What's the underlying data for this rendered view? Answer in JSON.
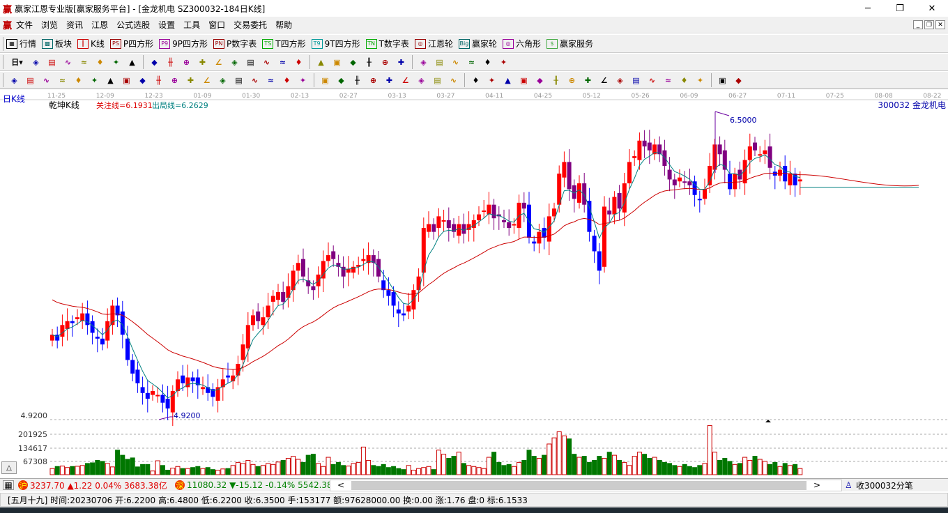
{
  "window": {
    "title": "赢家江恩专业版[赢家服务平台] - [金龙机电  SZ300032-184日K线]",
    "logo": "赢",
    "minimize": "─",
    "maximize": "❐",
    "close": "✕"
  },
  "menu": [
    "文件",
    "浏览",
    "资讯",
    "江恩",
    "公式选股",
    "设置",
    "工具",
    "窗口",
    "交易委托",
    "帮助"
  ],
  "mdi": [
    "_",
    "❐",
    "✕"
  ],
  "toolbar1": [
    {
      "icon": "quote-table-icon",
      "badge": "▦",
      "label": "行情"
    },
    {
      "icon": "sector-icon",
      "badge": "▩",
      "label": "板块"
    },
    {
      "icon": "kline-icon",
      "badge": "┃",
      "label": "K线"
    },
    {
      "icon": "ps-icon",
      "badge": "PS",
      "label": "P四方形"
    },
    {
      "icon": "p9-icon",
      "badge": "P9",
      "label": "9P四方形"
    },
    {
      "icon": "pn-icon",
      "badge": "PN",
      "label": "P数字表"
    },
    {
      "icon": "ts-icon",
      "badge": "TS",
      "label": "T四方形"
    },
    {
      "icon": "t9-icon",
      "badge": "T9",
      "label": "9T四方形"
    },
    {
      "icon": "tn-icon",
      "badge": "TN",
      "label": "T数字表"
    },
    {
      "icon": "gann-wheel-icon",
      "badge": "◎",
      "label": "江恩轮"
    },
    {
      "icon": "big-wheel-icon",
      "badge": "Big",
      "label": "赢家轮"
    },
    {
      "icon": "hexagon-icon",
      "badge": "◎",
      "label": "六角形"
    },
    {
      "icon": "dollar-icon",
      "badge": "$",
      "label": "赢家服务"
    }
  ],
  "toolbar2": {
    "period": "日",
    "icons": [
      "chart-type-icon",
      "notes-icon",
      "wave3-icon",
      "wave9-icon",
      "candle-style-icon",
      "kline-select-icon",
      "flag-icon",
      "|",
      "first-icon",
      "last-icon",
      "left-icon",
      "right-icon",
      "move-left-icon",
      "move-right-icon",
      "zoom-in-icon",
      "zoom-out-icon",
      "expand-icon",
      "fit-icon",
      "|",
      "hand-icon",
      "crosshair-icon",
      "line-tool-icon",
      "wave-icon",
      "section-icon",
      "trend-icon",
      "|",
      "calendar-icon",
      "calculator-icon",
      "report-icon",
      "save-icon",
      "network-icon",
      "export-icon"
    ]
  },
  "toolbar3": {
    "icons": [
      "pen-icon",
      "grid-icon",
      "gold-icon",
      "gold2-icon",
      "fib-icon",
      "spiral-icon",
      "rocket-icon",
      "circle-icon",
      "lines-icon",
      "n2-icon",
      "angle-icon",
      "target-icon",
      "star-icon",
      "square-icon",
      "parallel-icon",
      "shen-icon",
      "ying-icon",
      "ruler-icon",
      "span-icon",
      "|",
      "box-icon",
      "fan-icon",
      "fan2-icon",
      "fan3-icon",
      "angle2-icon",
      "zigzag-icon",
      "grid2-icon",
      "grid3-icon",
      "multiline-icon",
      "|",
      "table-icon",
      "percent-fan-icon",
      "percent-icon",
      "percent-line-icon",
      "gold-circle-icon",
      "gold-line-icon",
      "arrow-icon",
      "wave-line-icon",
      "gold3-icon",
      "j-icon",
      "f-icon",
      "gold4-icon",
      "shen2-icon",
      "ying2-icon",
      "box2-icon",
      "|",
      "ball-icon",
      "infinity-icon"
    ]
  },
  "chart": {
    "period_label": "日K线",
    "indicator": "乾坤K线",
    "focus": "关注线=6.1931",
    "exit": "出局线=6.2629",
    "stock": "300032  金龙机电",
    "high_label": "6.5000",
    "low_label": "4.9200",
    "low_axis": "4.9200",
    "dates": [
      "11-25",
      "12-09",
      "12-23",
      "01-09",
      "01-30",
      "02-13",
      "02-27",
      "03-13",
      "03-27",
      "04-11",
      "04-25",
      "05-12",
      "05-26",
      "06-09",
      "06-27",
      "07-11",
      "07-25",
      "08-08",
      "08-22"
    ],
    "vol_axis": [
      "201925",
      "134617",
      "67308"
    ],
    "colors": {
      "up": "#ff0000",
      "down": "#0000ff",
      "mid": "#800080",
      "ma_short": "#008080",
      "ma_long": "#cc0000",
      "vol_up": "#cc0000",
      "vol_down": "#007700"
    }
  },
  "chart_data": {
    "type": "candlestick",
    "ylim": [
      4.92,
      6.5
    ],
    "close": [
      5.35,
      5.32,
      5.4,
      5.42,
      5.41,
      5.44,
      5.46,
      5.4,
      5.36,
      5.33,
      5.3,
      5.42,
      5.5,
      5.45,
      5.35,
      5.22,
      5.15,
      5.1,
      5.05,
      5.02,
      5.06,
      5.04,
      5.0,
      4.97,
      5.06,
      5.12,
      5.1,
      5.13,
      5.11,
      5.09,
      5.08,
      5.05,
      5.03,
      5.08,
      5.12,
      5.13,
      5.14,
      5.2,
      5.3,
      5.4,
      5.45,
      5.42,
      5.44,
      5.5,
      5.55,
      5.57,
      5.52,
      5.6,
      5.68,
      5.72,
      5.65,
      5.6,
      5.58,
      5.66,
      5.73,
      5.76,
      5.74,
      5.7,
      5.65,
      5.69,
      5.7,
      5.71,
      5.74,
      5.76,
      5.72,
      5.65,
      5.58,
      5.55,
      5.5,
      5.46,
      5.45,
      5.5,
      5.58,
      5.65,
      5.9,
      5.92,
      5.88,
      5.96,
      5.94,
      5.9,
      5.88,
      5.92,
      5.87,
      5.92,
      5.94,
      5.97,
      5.99,
      6.02,
      5.95,
      5.96,
      5.93,
      5.9,
      5.92,
      6.03,
      6.0,
      5.85,
      5.82,
      5.88,
      5.85,
      5.96,
      6.0,
      6.18,
      6.24,
      6.1,
      6.05,
      6.13,
      6.02,
      5.88,
      5.78,
      5.68,
      6.01,
      5.97,
      6.06,
      6.0,
      6.13,
      6.24,
      6.27,
      6.35,
      6.32,
      6.3,
      6.33,
      6.28,
      6.22,
      6.15,
      6.12,
      6.16,
      6.14,
      6.12,
      6.07,
      6.05,
      6.1,
      6.22,
      6.33,
      6.28,
      6.2,
      6.1,
      6.18,
      6.15,
      6.25,
      6.32,
      6.3,
      6.28,
      6.3,
      6.21,
      6.17,
      6.2,
      6.14,
      6.18,
      6.12,
      6.15
    ],
    "volume_k": [
      30,
      40,
      42,
      35,
      40,
      41,
      45,
      55,
      58,
      70,
      65,
      55,
      38,
      120,
      95,
      75,
      82,
      38,
      50,
      50,
      18,
      68,
      45,
      22,
      32,
      40,
      30,
      30,
      35,
      40,
      30,
      35,
      25,
      22,
      28,
      30,
      45,
      60,
      55,
      70,
      50,
      40,
      45,
      55,
      50,
      62,
      70,
      80,
      90,
      75,
      60,
      95,
      100,
      55,
      40,
      85,
      50,
      60,
      45,
      42,
      55,
      60,
      135,
      70,
      45,
      40,
      50,
      35,
      40,
      30,
      25,
      45,
      22,
      30,
      35,
      40,
      25,
      120,
      100,
      80,
      90,
      110,
      55,
      45,
      40,
      35,
      30,
      85,
      110,
      60,
      45,
      50,
      40,
      60,
      70,
      120,
      90,
      80,
      95,
      150,
      180,
      210,
      190,
      175,
      100,
      85,
      90,
      60,
      70,
      90,
      80,
      110,
      95,
      70,
      60,
      45,
      90,
      110,
      100,
      80,
      85,
      70,
      60,
      55,
      45,
      40,
      50,
      40,
      35,
      45,
      55,
      240,
      110,
      70,
      80,
      65,
      50,
      55,
      85,
      70,
      90,
      75,
      65,
      50,
      60,
      40,
      55,
      45,
      50,
      30
    ],
    "vol_ylim": [
      0,
      269233
    ]
  },
  "quotes": {
    "sh_badge": "沪",
    "sh": "3237.70 ▲1.22 0.04% 3683.38亿",
    "sz_badge": "深",
    "sz": "11080.32 ▼-15.12 -0.14% 5542.38",
    "tick": "收300032分笔",
    "scroll_left": "<",
    "scroll_right": ">"
  },
  "info": "[五月十九] 时间:20230706 开:6.2200 高:6.4800 低:6.2200 收:6.3500 手:153177 额:97628000.00 换:0.00 涨:1.76 盘:0 标:6.1533",
  "collapse": "△"
}
